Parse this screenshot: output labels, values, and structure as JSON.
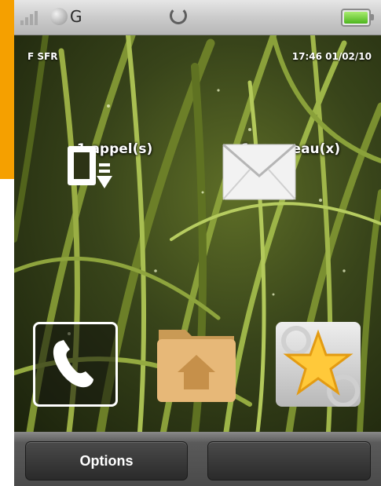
{
  "status_bar": {
    "network_type": "G",
    "icons": [
      "signal-icon",
      "globe-icon",
      "sync-icon",
      "battery-icon"
    ],
    "battery_color": "#4cb51e"
  },
  "home": {
    "operator": "F SFR",
    "datetime": "17:46 01/02/10",
    "missed_calls": {
      "label": "1 appel(s)",
      "icon": "missed-call-icon"
    },
    "new_messages": {
      "label": "1 nouveau(x)",
      "icon": "envelope-icon"
    },
    "shortcuts": [
      {
        "name": "phone",
        "icon": "phone-icon"
      },
      {
        "name": "home-folder",
        "icon": "home-folder-icon"
      },
      {
        "name": "favorites",
        "icon": "star-icon"
      }
    ]
  },
  "softkeys": {
    "left": "Options",
    "right": ""
  },
  "colors": {
    "accent_strip": "#f5a000",
    "softkey": "#333333"
  }
}
